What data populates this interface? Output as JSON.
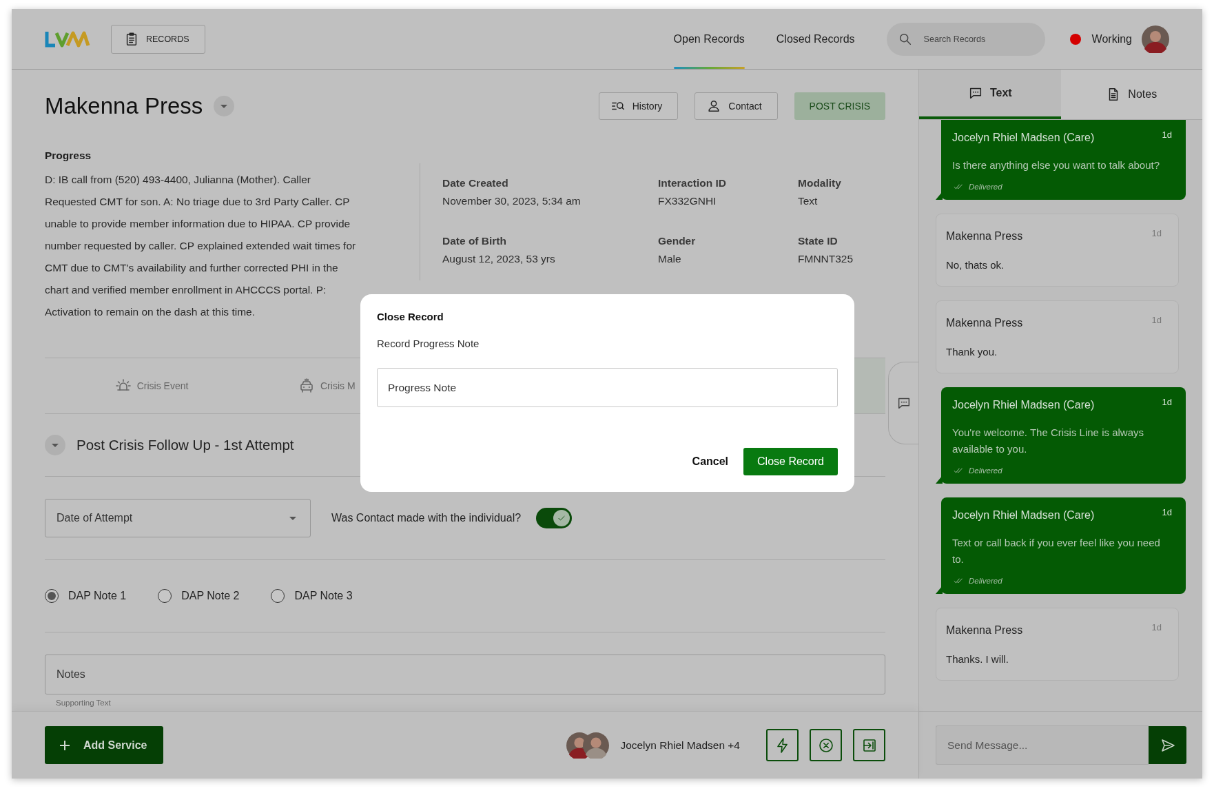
{
  "header": {
    "nav_button": "RECORDS",
    "tabs": [
      {
        "label": "Open Records",
        "selected": true
      },
      {
        "label": "Closed Records",
        "selected": false
      }
    ],
    "search": {
      "placeholder": "Search Records"
    },
    "status": {
      "label": "Working",
      "color": "#d40000"
    }
  },
  "record": {
    "name": "Makenna Press",
    "actions": [
      "History",
      "Contact"
    ],
    "status_button": "POST CRISIS"
  },
  "progress": {
    "title": "Progress",
    "text": "D: IB call from (520) 493-4400, Julianna (Mother). Caller Requested CMT for son. A: No triage due to 3rd Party Caller. CP unable to provide member information due to HIPAA. CP provide number requested by caller. CP explained extended wait times for CMT due to CMT's availability and further corrected PHI in the chart and verified member enrollment in AHCCCS portal. P: Activation to remain on the dash at this time."
  },
  "details": [
    {
      "label": "Date Created",
      "value": "November 30, 2023, 5:34 am"
    },
    {
      "label": "Interaction ID",
      "value": "FX332GNHI"
    },
    {
      "label": "Modality",
      "value": "Text"
    },
    {
      "label": "Date of Birth",
      "value": "August 12, 2023, 53 yrs"
    },
    {
      "label": "Gender",
      "value": "Male"
    },
    {
      "label": "State ID",
      "value": "FMNNT325"
    }
  ],
  "event_tabs": [
    {
      "label": "Crisis Event"
    },
    {
      "label": "Crisis M"
    }
  ],
  "follow_up": {
    "title": "Post Crisis Follow Up - 1st Attempt",
    "date_field": {
      "placeholder": "Date of Attempt"
    },
    "contact_question": "Was Contact made with the individual?",
    "contact_made": true,
    "dap_notes": [
      {
        "label": "DAP Note 1",
        "selected": true
      },
      {
        "label": "DAP Note 2",
        "selected": false
      },
      {
        "label": "DAP Note 3",
        "selected": false
      }
    ],
    "notes": {
      "placeholder": "Notes",
      "supporting_text": "Supporting Text"
    }
  },
  "footer": {
    "add_button": "Add Service",
    "participants": "Jocelyn Rhiel Madsen +4"
  },
  "panel": {
    "tabs": [
      {
        "label": "Text",
        "selected": true
      },
      {
        "label": "Notes",
        "selected": false
      }
    ],
    "messages": [
      {
        "kind": "outgoing",
        "sender": "Jocelyn Rhiel Madsen (Care)",
        "time": "1d",
        "text": "Is there anything else you want to talk about?",
        "status": "Delivered"
      },
      {
        "kind": "incoming",
        "sender": "Makenna Press",
        "time": "1d",
        "text": "No, thats ok."
      },
      {
        "kind": "incoming",
        "sender": "Makenna Press",
        "time": "1d",
        "text": "Thank you."
      },
      {
        "kind": "outgoing",
        "sender": "Jocelyn Rhiel Madsen (Care)",
        "time": "1d",
        "text": "You're welcome. The Crisis Line is always available to you.",
        "status": "Delivered"
      },
      {
        "kind": "outgoing",
        "sender": "Jocelyn Rhiel Madsen (Care)",
        "time": "1d",
        "text": "Text or call back if you ever feel like you need to.",
        "status": "Delivered"
      },
      {
        "kind": "incoming",
        "sender": "Makenna Press",
        "time": "1d",
        "text": "Thanks. I will."
      }
    ],
    "composer": {
      "placeholder": "Send Message..."
    }
  },
  "dialog": {
    "title": "Close Record",
    "subtitle": "Record Progress Note",
    "field": {
      "placeholder": "Progress Note"
    },
    "buttons": [
      "Cancel",
      "Close Record"
    ]
  }
}
